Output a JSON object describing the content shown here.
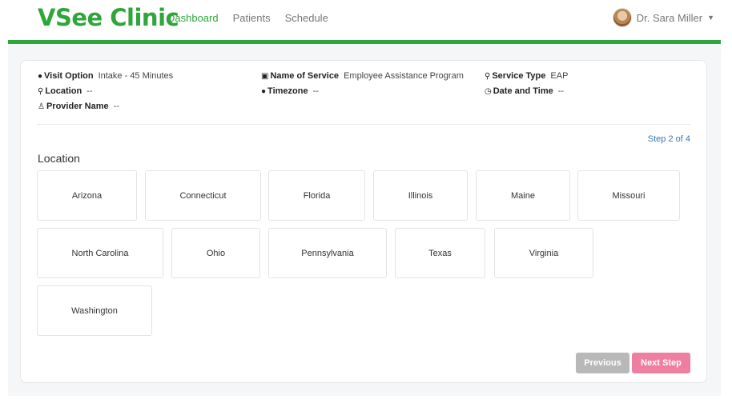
{
  "header": {
    "brand": "VSee Clinic",
    "nav": [
      {
        "label": "Dashboard",
        "active": true
      },
      {
        "label": "Patients",
        "active": false
      },
      {
        "label": "Schedule",
        "active": false
      }
    ],
    "user_name": "Dr. Sara Miller"
  },
  "summary": {
    "visit_option": {
      "label": "Visit Option",
      "value": "Intake - 45 Minutes"
    },
    "location": {
      "label": "Location",
      "value": "--"
    },
    "provider_name": {
      "label": "Provider Name",
      "value": "--"
    },
    "service_name": {
      "label": "Name of Service",
      "value": "Employee Assistance Program"
    },
    "timezone": {
      "label": "Timezone",
      "value": "--"
    },
    "service_type": {
      "label": "Service Type",
      "value": "EAP"
    },
    "date_time": {
      "label": "Date and Time",
      "value": "--"
    }
  },
  "step_indicator": "Step 2 of 4",
  "section_title": "Location",
  "locations": [
    "Arizona",
    "Connecticut",
    "Florida",
    "Illinois",
    "Maine",
    "Missouri",
    "North Carolina",
    "Ohio",
    "Pennsylvania",
    "Texas",
    "Virginia",
    "Washington"
  ],
  "buttons": {
    "previous": "Previous",
    "next": "Next Step"
  },
  "colors": {
    "brand_green": "#2fa63a",
    "link_blue": "#3a76b5",
    "next_pink": "#ef7fa0",
    "prev_gray": "#b8b8b8"
  }
}
